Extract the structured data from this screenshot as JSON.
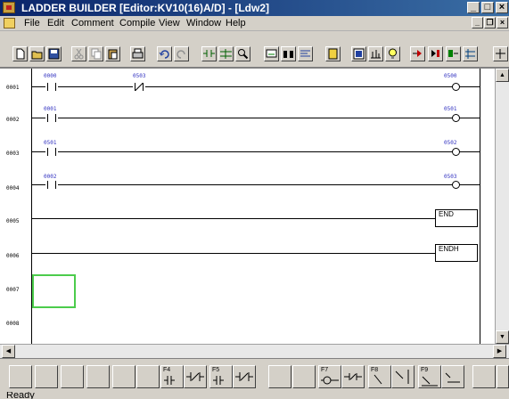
{
  "window": {
    "title": "LADDER BUILDER    [Editor:KV10(16)A/D]  - [Ldw2]",
    "minimize": "_",
    "restore": "□",
    "close": "×"
  },
  "menu": {
    "items": [
      "File",
      "Edit",
      "Comment",
      "Compile",
      "View",
      "Window",
      "Help"
    ],
    "mdi_min": "_",
    "mdi_restore": "❐",
    "mdi_close": "×"
  },
  "ladder": {
    "rows": [
      {
        "num": "0001",
        "c1": "0000",
        "c2": "0503",
        "coil": "0500"
      },
      {
        "num": "0002",
        "c1": "0001",
        "coil": "0501"
      },
      {
        "num": "0003",
        "c1": "0501",
        "coil": "0502"
      },
      {
        "num": "0004",
        "c1": "0002",
        "coil": "0503"
      },
      {
        "num": "0005",
        "box": "END"
      },
      {
        "num": "0006",
        "box": "ENDH"
      },
      {
        "num": "0007"
      },
      {
        "num": "0008"
      }
    ]
  },
  "fkeys": {
    "f4": "F4",
    "f5": "F5",
    "f7": "F7",
    "f8": "F8",
    "f9": "F9"
  },
  "status": {
    "text": "Ready"
  }
}
